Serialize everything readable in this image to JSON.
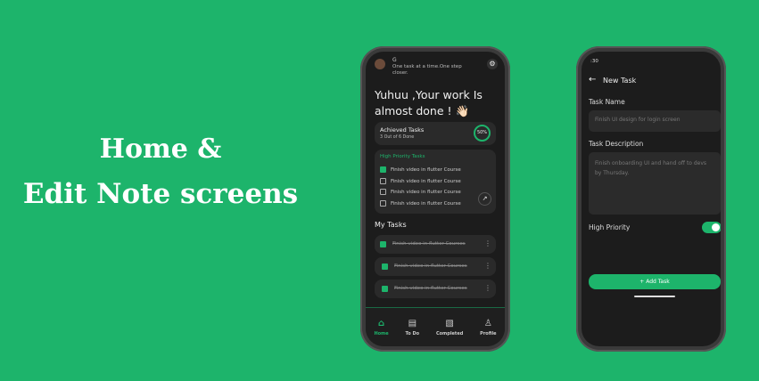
{
  "headline": {
    "line1": "Home &",
    "line2": "Edit Note screens"
  },
  "colors": {
    "background": "#1db46b",
    "accent": "#1db46b",
    "screen": "#1c1c1c",
    "card": "#2a2a2a"
  },
  "home": {
    "user_initial": "G",
    "tagline": "One task at a time.One step closer.",
    "greeting": "Yuhuu ,Your work Is almost done ! 👋🏻",
    "achieved": {
      "title": "Achieved Tasks",
      "subtitle": "3 Out of 6 Done",
      "progress_label": "50%",
      "progress": 0.5
    },
    "high_priority": {
      "title": "High Priority Tasks",
      "items": [
        {
          "label": "Finish video in flutter Course",
          "checked": true
        },
        {
          "label": "Finish video in flutter Course",
          "checked": false
        },
        {
          "label": "Finish video in flutter Course",
          "checked": false
        },
        {
          "label": "Finish video in flutter Course",
          "checked": false
        }
      ]
    },
    "my_tasks": {
      "title": "My Tasks",
      "items": [
        {
          "label": "Finish video in flutter Courses",
          "checked": true
        },
        {
          "label": "Finish video in flutter Courses",
          "checked": true
        },
        {
          "label": "Finish video in flutter Courses",
          "checked": true
        }
      ]
    },
    "nav": [
      {
        "label": "Home",
        "icon": "home-icon"
      },
      {
        "label": "To Do",
        "icon": "todo-icon"
      },
      {
        "label": "Completed",
        "icon": "completed-icon"
      },
      {
        "label": "Profile",
        "icon": "profile-icon"
      }
    ]
  },
  "edit": {
    "status_time": ":30",
    "title": "New Task",
    "task_name_label": "Task Name",
    "task_name_placeholder": "Finish UI design for login screen",
    "desc_label": "Task Description",
    "desc_placeholder": "Finish onboarding UI and hand off to devs by Thursday.",
    "priority_label": "High Priority",
    "priority_on": true,
    "add_button": "Add Task"
  }
}
